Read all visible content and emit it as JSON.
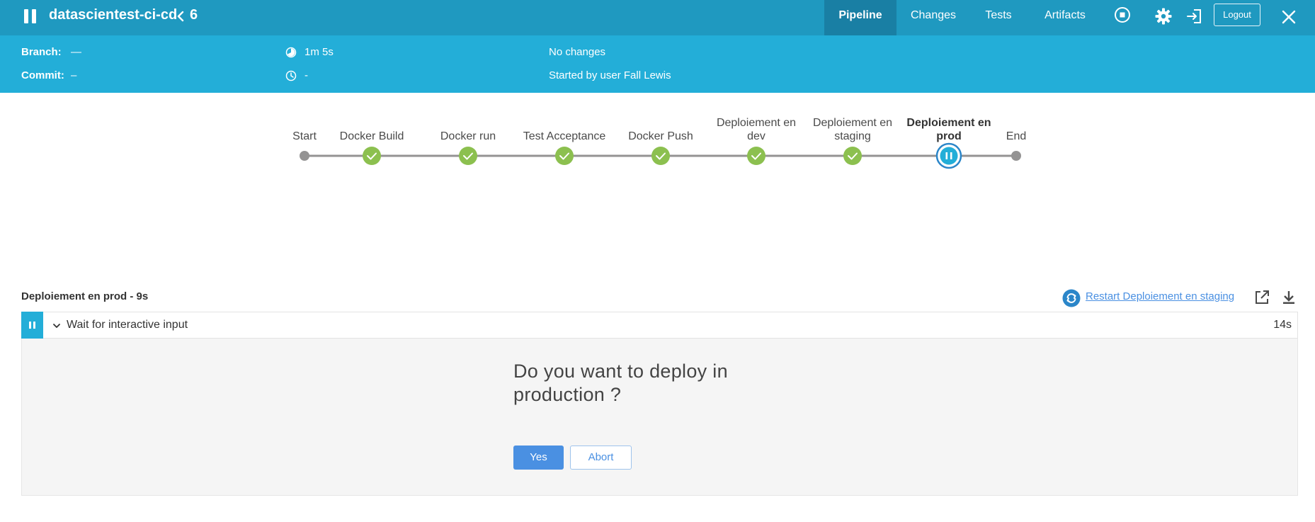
{
  "header": {
    "title": "datascientest-ci-cd",
    "run_number": "6",
    "tabs": [
      {
        "label": "Pipeline",
        "active": true
      },
      {
        "label": "Changes",
        "active": false
      },
      {
        "label": "Tests",
        "active": false
      },
      {
        "label": "Artifacts",
        "active": false
      }
    ],
    "logout_label": "Logout",
    "colors": {
      "topbar": "#1f99c0",
      "active_tab": "#197fa4",
      "subbar": "#23aed8"
    }
  },
  "run_info": {
    "branch_label": "Branch:",
    "branch_value": "—",
    "commit_label": "Commit:",
    "commit_value": "–",
    "duration": "1m 5s",
    "time": "-",
    "changes": "No changes",
    "started_by": "Started by user Fall Lewis"
  },
  "pipeline": {
    "stages": [
      {
        "label": "Start",
        "status": "none"
      },
      {
        "label": "Docker Build",
        "status": "success"
      },
      {
        "label": "Docker run",
        "status": "success"
      },
      {
        "label": "Test Acceptance",
        "status": "success"
      },
      {
        "label": "Docker Push",
        "status": "success"
      },
      {
        "label": "Deploiement en dev",
        "status": "success"
      },
      {
        "label": "Deploiement en staging",
        "status": "success"
      },
      {
        "label": "Deploiement en prod",
        "status": "paused",
        "selected": true
      },
      {
        "label": "End",
        "status": "none"
      }
    ],
    "colors": {
      "success": "#8cc04f",
      "paused": "#23aed8",
      "node": "#949393",
      "line": "#949393"
    }
  },
  "step_panel": {
    "title": "Deploiement en prod - 9s",
    "restart_label": "Restart Deploiement en staging",
    "step_name": "Wait for interactive input",
    "step_duration": "14s",
    "question": "Do you want to deploy in production ?",
    "yes_label": "Yes",
    "abort_label": "Abort"
  }
}
